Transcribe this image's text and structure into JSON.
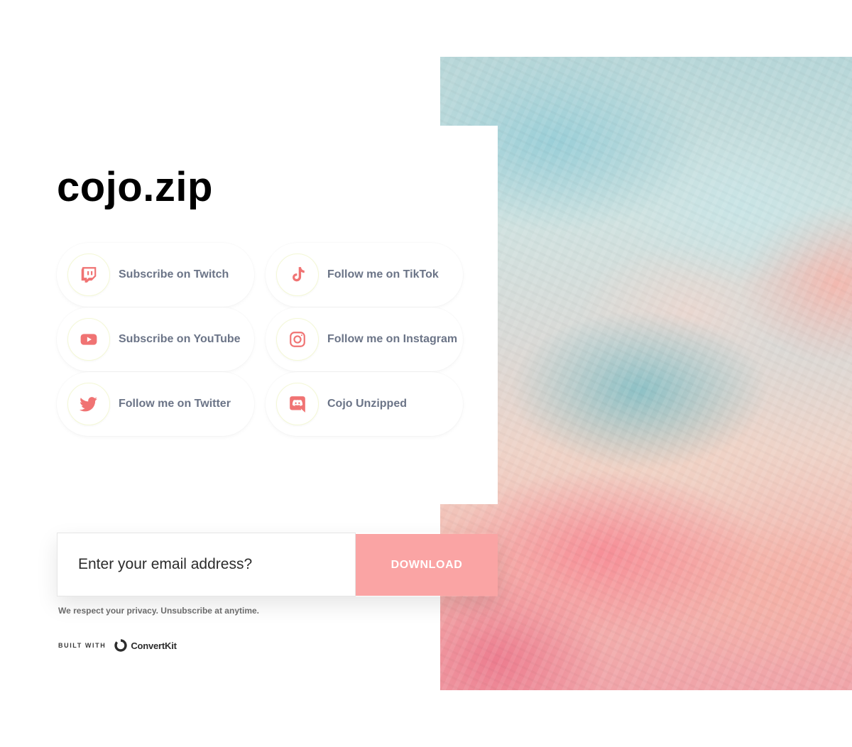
{
  "page": {
    "title": "cojo.zip"
  },
  "links": [
    {
      "label": "Subscribe on Twitch",
      "icon": "twitch-icon"
    },
    {
      "label": "Follow me on TikTok",
      "icon": "tiktok-icon"
    },
    {
      "label": "Subscribe on YouTube",
      "icon": "youtube-icon"
    },
    {
      "label": "Follow me on Instagram",
      "icon": "instagram-icon"
    },
    {
      "label": "Follow me on Twitter",
      "icon": "twitter-icon"
    },
    {
      "label": "Cojo Unzipped",
      "icon": "discord-icon"
    }
  ],
  "form": {
    "email_placeholder": "Enter your email address?",
    "email_value": "",
    "download_label": "DOWNLOAD",
    "privacy_text": "We respect your privacy. Unsubscribe at anytime."
  },
  "footer": {
    "built_with_label": "BUILT WITH",
    "brand_name": "ConvertKit",
    "brand_icon": "convertkit-logo-icon"
  },
  "colors": {
    "accent_icon": "#f07373",
    "button_bg": "#faa4a4",
    "label_text": "#6b7487",
    "icon_ring": "#f4f8d6"
  }
}
